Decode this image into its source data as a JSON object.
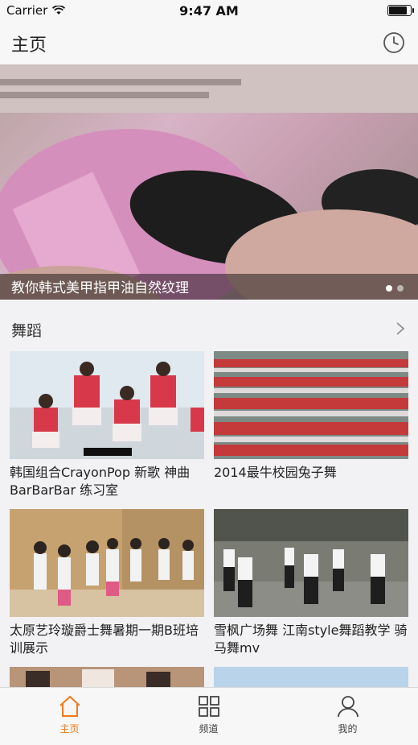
{
  "status": {
    "carrier": "Carrier",
    "time": "9:47 AM"
  },
  "nav": {
    "title": "主页"
  },
  "banner": {
    "caption": "教你韩式美甲指甲油自然纹理",
    "active_dot": 0
  },
  "section": {
    "title": "舞蹈"
  },
  "cards": [
    {
      "title": "韩国组合CrayonPop 新歌 神曲 BarBarBar 练习室"
    },
    {
      "title": "2014最牛校园兔子舞"
    },
    {
      "title": "太原艺玲璇爵士舞暑期一期B班培训展示"
    },
    {
      "title": "雪枫广场舞 江南style舞蹈教学 骑马舞mv"
    }
  ],
  "tabbar": {
    "active_color": "#f07a1a",
    "items": [
      {
        "label": "主页",
        "icon": "home-icon"
      },
      {
        "label": "频道",
        "icon": "grid-icon"
      },
      {
        "label": "我的",
        "icon": "person-icon"
      }
    ]
  }
}
